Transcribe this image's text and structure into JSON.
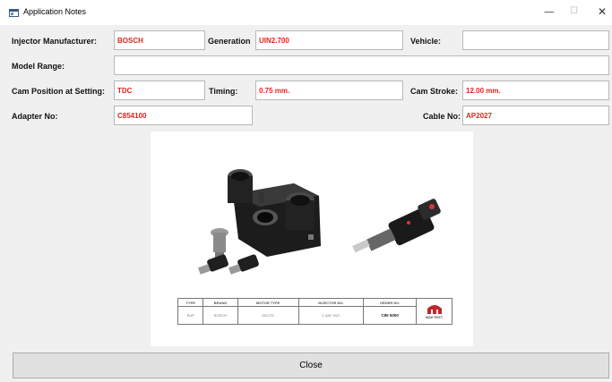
{
  "window": {
    "title": "Application Notes",
    "minimize_glyph": "—",
    "maximize_glyph": "☐",
    "close_glyph": "✕"
  },
  "form": {
    "injector_manufacturer": {
      "label": "Injector Manufacturer:",
      "value": "BOSCH"
    },
    "generation": {
      "label": "Generation",
      "value": "UIN2.700"
    },
    "vehicle": {
      "label": "Vehicle:",
      "value": ""
    },
    "model_range": {
      "label": "Model Range:",
      "value": ""
    },
    "cam_position": {
      "label": "Cam Position at Setting:",
      "value": "TDC"
    },
    "timing": {
      "label": "Timing:",
      "value": "0.75 mm."
    },
    "cam_stroke": {
      "label": "Cam Stroke:",
      "value": "12.00 mm."
    },
    "adapter_no": {
      "label": "Adapter No:",
      "value": "C854100"
    },
    "cable_no": {
      "label": "Cable No:",
      "value": "AP2027"
    },
    "value_color": "#e8231f"
  },
  "picture": {
    "spec_table": {
      "headers": [
        "TYPE",
        "BRAND",
        "MOTOR TYPE",
        "INJECTOR NO.",
        "ORDER NO."
      ],
      "row": [
        "EUP",
        "BOSCH",
        "DEUTZ",
        "0 428 7047",
        "C85 5000"
      ],
      "brand_logo_text": "MAKTEST"
    }
  },
  "close_button": {
    "label": "Close"
  }
}
